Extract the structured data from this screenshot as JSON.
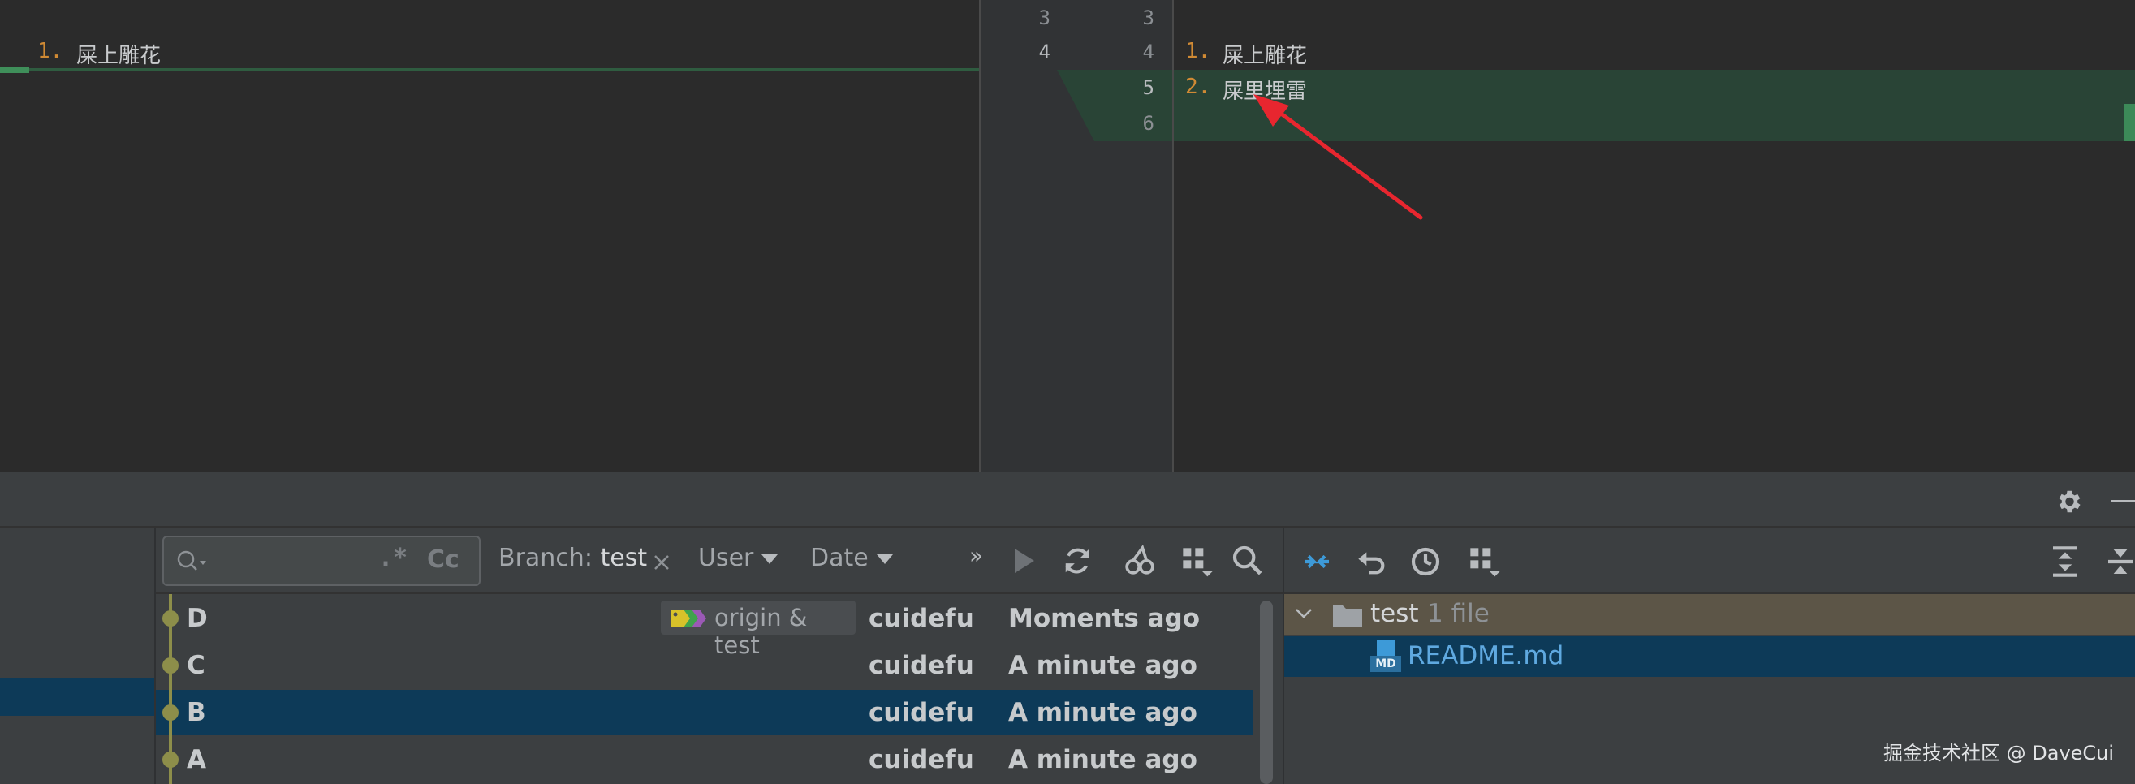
{
  "diff": {
    "left_lines": [
      {
        "num": "1.",
        "text": "屎上雕花"
      }
    ],
    "gutter": [
      {
        "left": "3",
        "right": "3"
      },
      {
        "left": "4",
        "right": "4"
      },
      {
        "left": "",
        "right": "5"
      },
      {
        "left": "",
        "right": "6"
      }
    ],
    "right_lines": [
      {
        "num": "1.",
        "text": "屎上雕花"
      },
      {
        "num": "2.",
        "text": "屎里埋雷"
      }
    ],
    "colors": {
      "added_bg": "#294436",
      "annotation_arrow": "#e8262f"
    }
  },
  "log_toolbar": {
    "search_placeholder": "",
    "regex_label": ".*",
    "case_label": "Cc",
    "branch_label": "Branch:",
    "branch_value": "test",
    "user_label": "User",
    "date_label": "Date"
  },
  "commits": [
    {
      "subject": "D",
      "refs": "origin & test",
      "author": "cuidefu",
      "date": "Moments ago",
      "selected": false
    },
    {
      "subject": "C",
      "refs": "",
      "author": "cuidefu",
      "date": "A minute ago",
      "selected": false
    },
    {
      "subject": "B",
      "refs": "",
      "author": "cuidefu",
      "date": "A minute ago",
      "selected": true
    },
    {
      "subject": "A",
      "refs": "",
      "author": "cuidefu",
      "date": "A minute ago",
      "selected": false
    }
  ],
  "changes": {
    "folder_name": "test",
    "folder_count": "1 file",
    "file_icon_label": "MD",
    "file_name": "README.md"
  },
  "watermark": "掘金技术社区 @ DaveCui"
}
